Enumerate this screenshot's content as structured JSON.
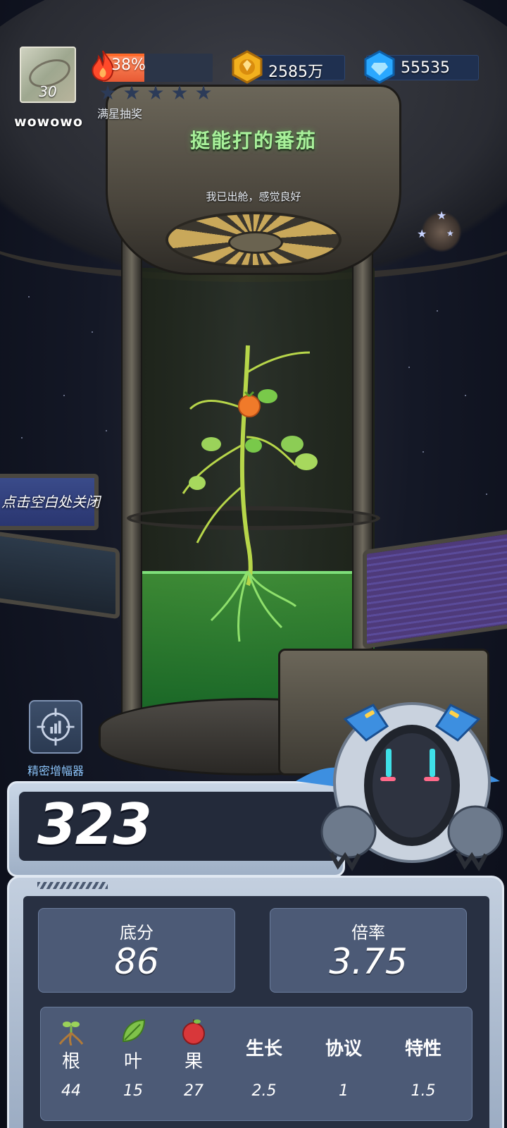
{
  "player": {
    "name": "wowowo",
    "level": "30"
  },
  "fire_progress": {
    "percent_text": "38%",
    "fraction": 0.38
  },
  "star_rating": {
    "filled": 0,
    "total": 5,
    "caption": "满星抽奖"
  },
  "currencies": {
    "coins": "2585万",
    "gems": "55535"
  },
  "plant": {
    "name": "挺能打的番茄",
    "status": "我已出舱，感觉良好"
  },
  "hints": {
    "close": "点击空白处关闭"
  },
  "tools": {
    "amplifier_label": "精密增幅器"
  },
  "score": {
    "total": "323",
    "base_label": "底分",
    "base_value": "86",
    "multiplier_label": "倍率",
    "multiplier_value": "3.75"
  },
  "attributes": [
    {
      "name": "根",
      "value": "44",
      "icon": "root-icon"
    },
    {
      "name": "叶",
      "value": "15",
      "icon": "leaf-icon"
    },
    {
      "name": "果",
      "value": "27",
      "icon": "fruit-icon"
    },
    {
      "name": "生长",
      "value": "2.5"
    },
    {
      "name": "协议",
      "value": "1"
    },
    {
      "name": "特性",
      "value": "1.5"
    }
  ],
  "colors": {
    "title_green": "#a8f09a",
    "fire_orange": "#e85a34",
    "gold": "#f2b01e",
    "gem_blue": "#2aa8ff",
    "panel_bg": "#283042",
    "tool_label": "#8ec6ff"
  }
}
